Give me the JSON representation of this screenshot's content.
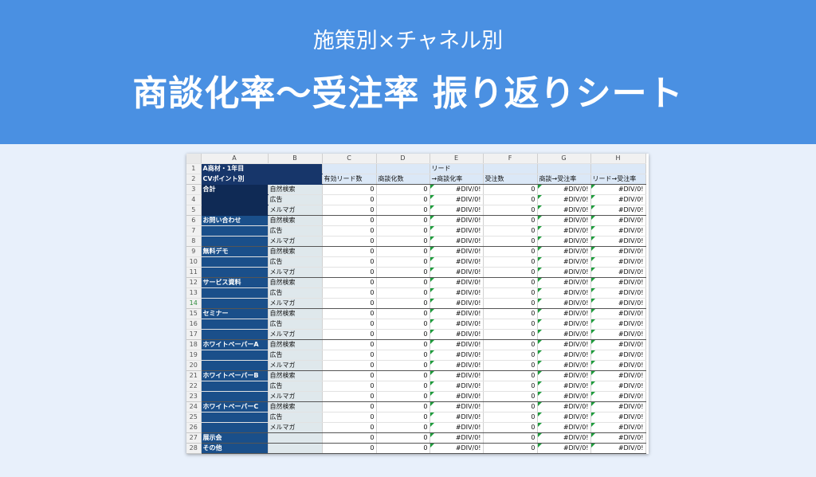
{
  "banner": {
    "subtitle": "施策別×チャネル別",
    "title": "商談化率〜受注率 振り返りシート"
  },
  "sheet": {
    "columns": [
      "A",
      "B",
      "C",
      "D",
      "E",
      "F",
      "G",
      "H"
    ],
    "header_row1": {
      "A": "A商材・1年目",
      "E": "リード"
    },
    "header_row2": {
      "A": "CVポイント別",
      "C": "有効リード数",
      "D": "商談化数",
      "E": "→商談化率",
      "F": "受注数",
      "G": "商談→受注率",
      "H": "リード→受注率"
    },
    "selected_row": "14",
    "groups": [
      {
        "category": "合計",
        "start": 3,
        "channels": [
          "自然検索",
          "広告",
          "メルマガ"
        ]
      },
      {
        "category": "お問い合わせ",
        "start": 6,
        "channels": [
          "自然検索",
          "広告",
          "メルマガ"
        ]
      },
      {
        "category": "無料デモ",
        "start": 9,
        "channels": [
          "自然検索",
          "広告",
          "メルマガ"
        ]
      },
      {
        "category": "サービス資料",
        "start": 12,
        "channels": [
          "自然検索",
          "広告",
          "メルマガ"
        ]
      },
      {
        "category": "セミナー",
        "start": 15,
        "channels": [
          "自然検索",
          "広告",
          "メルマガ"
        ]
      },
      {
        "category": "ホワイトペーパーA",
        "start": 18,
        "channels": [
          "自然検索",
          "広告",
          "メルマガ"
        ]
      },
      {
        "category": "ホワイトペーパーB",
        "start": 21,
        "channels": [
          "自然検索",
          "広告",
          "メルマガ"
        ]
      },
      {
        "category": "ホワイトペーパーC",
        "start": 24,
        "channels": [
          "自然検索",
          "広告",
          "メルマガ"
        ]
      },
      {
        "category": "展示会",
        "start": 27,
        "channels": [
          ""
        ]
      },
      {
        "category": "その他",
        "start": 28,
        "channels": [
          ""
        ]
      }
    ],
    "cell_values": {
      "C": "0",
      "D": "0",
      "E": "#DIV/0!",
      "F": "0",
      "G": "#DIV/0!",
      "H": "#DIV/0!"
    },
    "colors": {
      "banner": "#4a90e2",
      "category_fill": "#1a4f8a",
      "subcategory_fill": "#dfe8ec",
      "header_fill": "#dbe8f7",
      "error_indicator": "#1e9c3c"
    }
  }
}
